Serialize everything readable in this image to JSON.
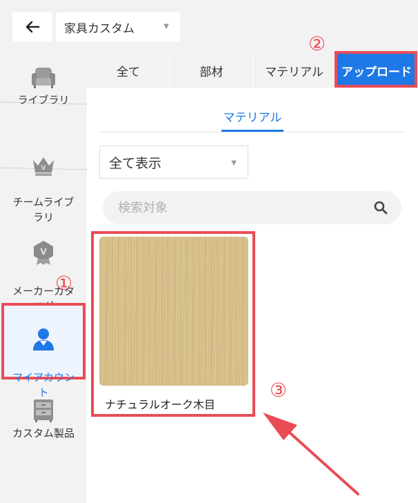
{
  "header": {
    "back_icon": "arrow-left-icon",
    "category_value": "家具カスタム"
  },
  "sidebar": {
    "items": [
      {
        "label": "ライブラリ",
        "icon": "sofa-icon"
      },
      {
        "label": "チームライブ\nラリ",
        "icon": "crown-icon"
      },
      {
        "label": "メーカーカタ\nログ",
        "icon": "badge-v-icon"
      },
      {
        "label": "マイアカウン\nト",
        "icon": "user-icon",
        "active": true
      },
      {
        "label": "カスタム製品",
        "icon": "cabinet-icon"
      }
    ]
  },
  "tabs": [
    {
      "label": "全て"
    },
    {
      "label": "部材"
    },
    {
      "label": "マテリアル"
    },
    {
      "label": "アップロード",
      "active": true
    }
  ],
  "subtab": {
    "label": "マテリアル"
  },
  "filter": {
    "value": "全て表示"
  },
  "search": {
    "placeholder": "検索対象"
  },
  "items": [
    {
      "label": "ナチュラルオーク木目"
    }
  ],
  "annotations": {
    "one": "①",
    "two": "②",
    "three": "③"
  },
  "colors": {
    "accent": "#1e78e6",
    "highlight": "#e94c55",
    "panel": "#f2f2f2"
  }
}
